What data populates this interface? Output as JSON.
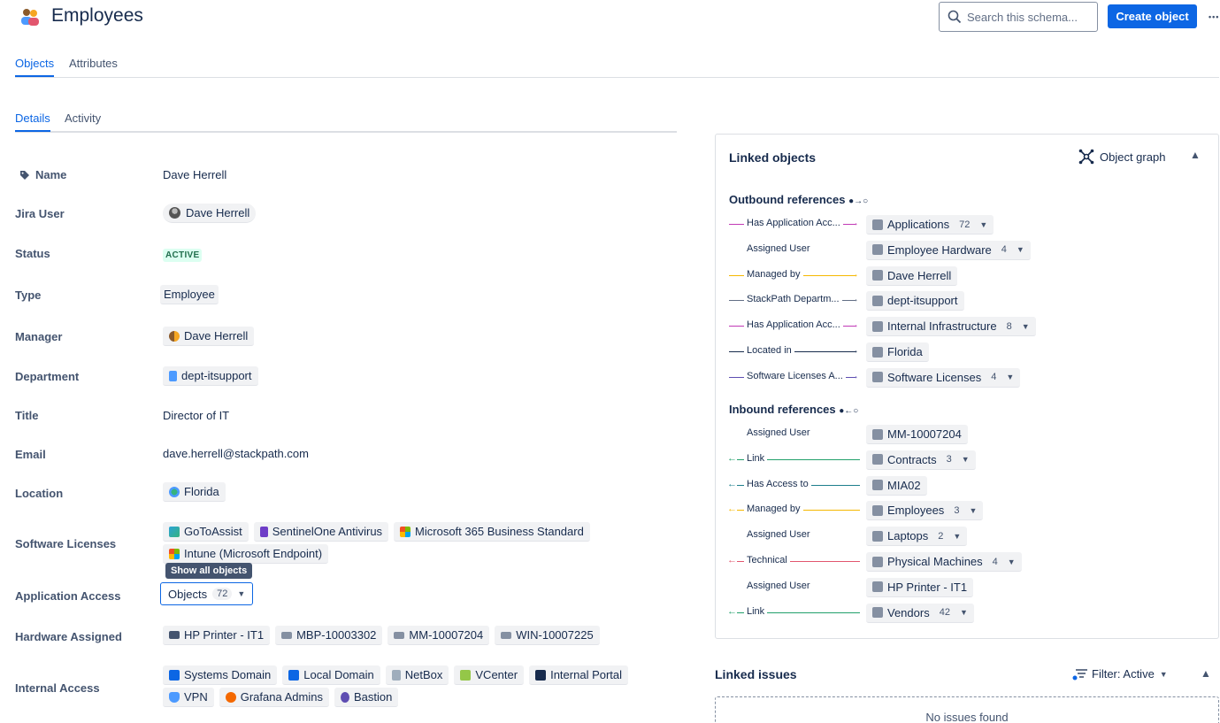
{
  "header": {
    "title": "Employees",
    "search_placeholder": "Search this schema...",
    "create_label": "Create object",
    "more_label": "•••"
  },
  "tabs": {
    "objects": "Objects",
    "attributes": "Attributes"
  },
  "subtabs": {
    "details": "Details",
    "activity": "Activity"
  },
  "details": {
    "name_label": "Name",
    "name_value": "Dave Herrell",
    "jira_user_label": "Jira User",
    "jira_user_value": "Dave Herrell",
    "status_label": "Status",
    "status_value": "ACTIVE",
    "type_label": "Type",
    "type_value": "Employee",
    "manager_label": "Manager",
    "manager_value": "Dave Herrell",
    "department_label": "Department",
    "department_value": "dept-itsupport",
    "title_label": "Title",
    "title_value": "Director of IT",
    "email_label": "Email",
    "email_value": "dave.herrell@stackpath.com",
    "location_label": "Location",
    "location_value": "Florida",
    "software_label": "Software Licenses",
    "software": [
      "GoToAssist",
      "SentinelOne Antivirus",
      "Microsoft 365 Business Standard",
      "Intune (Microsoft Endpoint)"
    ],
    "tooltip": "Show all objects",
    "app_access_label": "Application Access",
    "app_access_value": "Objects",
    "app_access_count": "72",
    "hardware_label": "Hardware Assigned",
    "hardware": [
      "HP Printer - IT1",
      "MBP-10003302",
      "MM-10007204",
      "WIN-10007225"
    ],
    "internal_label": "Internal Access",
    "internal": [
      "Systems Domain",
      "Local Domain",
      "NetBox",
      "VCenter",
      "Internal Portal",
      "VPN",
      "Grafana Admins",
      "Bastion"
    ]
  },
  "linked_objects": {
    "title": "Linked objects",
    "graph_label": "Object graph",
    "outbound_title": "Outbound references",
    "inbound_title": "Inbound references",
    "outbound": [
      {
        "label": "Has Application Acc...",
        "target": "Applications",
        "count": "72",
        "color": "#c13ab6"
      },
      {
        "label": "Assigned User",
        "target": "Employee Hardware",
        "count": "4",
        "color": ""
      },
      {
        "label": "Managed by",
        "target": "Dave Herrell",
        "count": "",
        "color": "#f5b800"
      },
      {
        "label": "StackPath Departm...",
        "target": "dept-itsupport",
        "count": "",
        "color": "#626f86"
      },
      {
        "label": "Has Application Acc...",
        "target": "Internal Infrastructure",
        "count": "8",
        "color": "#c13ab6"
      },
      {
        "label": "Located in",
        "target": "Florida",
        "count": "",
        "color": "#172b4d"
      },
      {
        "label": "Software Licenses A...",
        "target": "Software Licenses",
        "count": "4",
        "color": "#5e4db2"
      }
    ],
    "inbound": [
      {
        "label": "Assigned User",
        "target": "MM-10007204",
        "count": "",
        "color": ""
      },
      {
        "label": "Link",
        "target": "Contracts",
        "count": "3",
        "color": "#22a06b"
      },
      {
        "label": "Has Access to",
        "target": "MIA02",
        "count": "",
        "color": "#1d7f8c"
      },
      {
        "label": "Managed by",
        "target": "Employees",
        "count": "3",
        "color": "#f5b800"
      },
      {
        "label": "Assigned User",
        "target": "Laptops",
        "count": "2",
        "color": ""
      },
      {
        "label": "Technical",
        "target": "Physical Machines",
        "count": "4",
        "color": "#e2566e"
      },
      {
        "label": "Assigned User",
        "target": "HP Printer - IT1",
        "count": "",
        "color": ""
      },
      {
        "label": "Link",
        "target": "Vendors",
        "count": "42",
        "color": "#22a06b"
      }
    ]
  },
  "linked_issues": {
    "title": "Linked issues",
    "filter_label": "Filter: Active",
    "empty_text": "No issues found"
  }
}
